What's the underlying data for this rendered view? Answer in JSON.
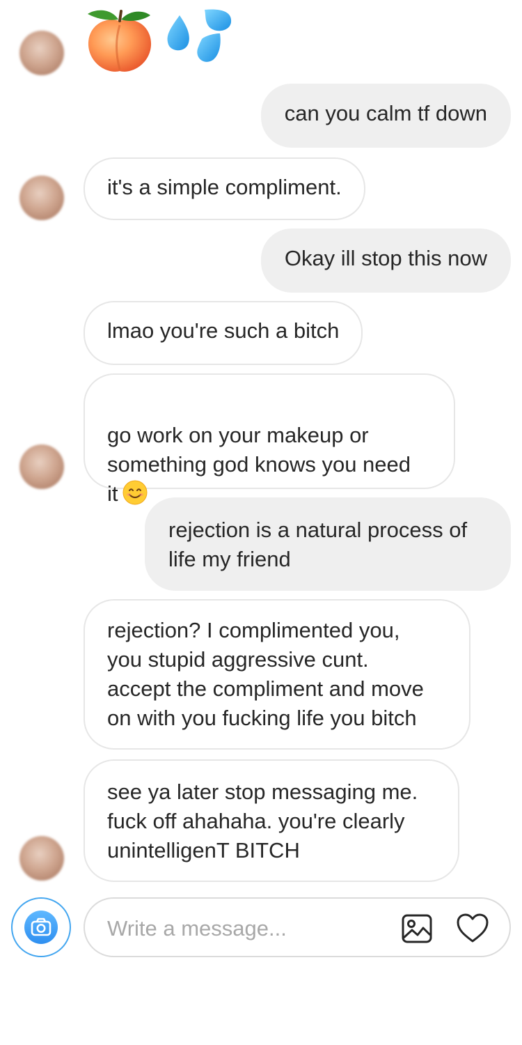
{
  "colors": {
    "incoming_bubble_bg": "#ffffff",
    "incoming_bubble_border": "#e6e6e6",
    "outgoing_bubble_bg": "#efefef",
    "text": "#262626",
    "placeholder": "#a8a8a8",
    "camera_blue": "#3897f0"
  },
  "thread": {
    "emoji_message": {
      "icons": [
        "peach-emoji",
        "sweat-droplets-emoji"
      ]
    },
    "messages": [
      {
        "direction": "outgoing",
        "text": "can you calm tf down"
      },
      {
        "direction": "incoming",
        "text": "it's a simple compliment."
      },
      {
        "direction": "outgoing",
        "text": "Okay ill stop this now"
      },
      {
        "direction": "incoming",
        "text": "lmao you're such a bitch"
      },
      {
        "direction": "incoming",
        "text": "go work on your makeup or\nsomething god knows you need\nit",
        "trailing_icon": "smiling-face-emoji"
      },
      {
        "direction": "outgoing",
        "text": "rejection is a natural process of\nlife my friend"
      },
      {
        "direction": "incoming",
        "text": "rejection? I complimented you,\nyou stupid aggressive cunt.\naccept the compliment and move\non with you fucking life you bitch"
      },
      {
        "direction": "incoming",
        "text": "see ya later stop messaging me.\nfuck off ahahaha. you're  clearly\nunintelligenT BITCH"
      }
    ]
  },
  "composer": {
    "placeholder": "Write a message...",
    "value": "",
    "icons": [
      "camera-icon",
      "gallery-icon",
      "heart-icon"
    ]
  }
}
